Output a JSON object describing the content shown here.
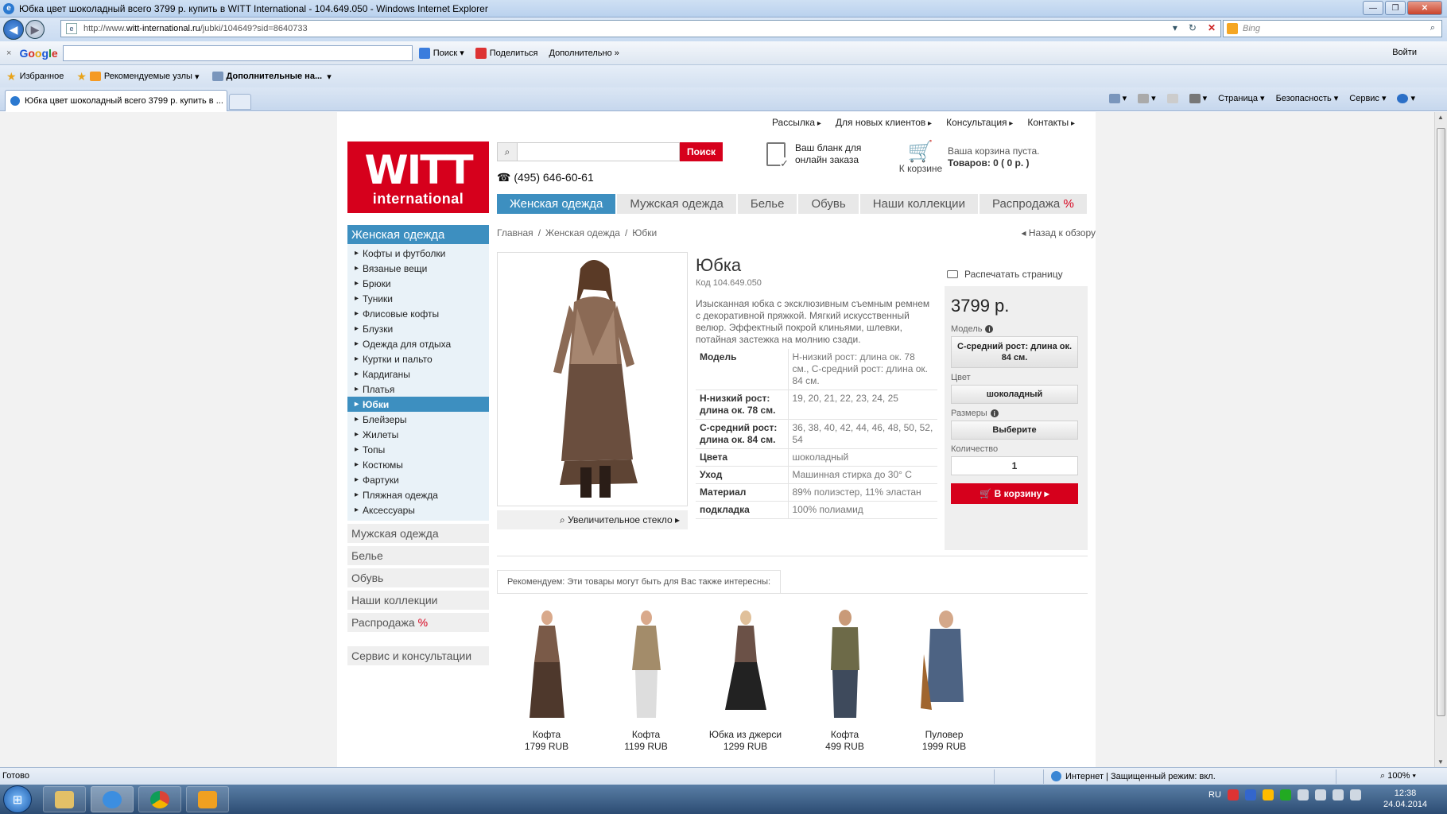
{
  "window": {
    "title": "Юбка цвет шоколадный всего 3799 р. купить в WITT International - 104.649.050 - Windows Internet Explorer",
    "url_prefix": "http://www.",
    "url_domain": "witt-international.ru",
    "url_path": "/jubki/104649?sid=8640733",
    "search_provider": "Bing"
  },
  "google_toolbar": {
    "close": "×",
    "search_label": "Поиск",
    "share_label": "Поделиться",
    "more_label": "Дополнительно »",
    "login_label": "Войти"
  },
  "favorites_bar": {
    "favorites": "Избранное",
    "suggested": "Рекомендуемые узлы",
    "addons": "Дополнительные на..."
  },
  "tabs": {
    "active_title": "Юбка цвет шоколадный всего 3799 р. купить в ..."
  },
  "command_bar": {
    "page": "Страница",
    "safety": "Безопасность",
    "service": "Сервис"
  },
  "site": {
    "top_links": [
      "Рассылка",
      "Для новых клиентов",
      "Консультация",
      "Контакты"
    ],
    "logo_main": "WITT",
    "logo_sub": "international",
    "search_button": "Поиск",
    "phone": "(495) 646-60-61",
    "order_form_line1": "Ваш бланк для",
    "order_form_line2": "онлайн заказа",
    "cart_link": "К корзине",
    "cart_empty": "Ваша корзина пуста.",
    "cart_items": "Товаров: 0 ( 0 р. )",
    "main_tabs": [
      {
        "label": "Женская одежда",
        "active": true
      },
      {
        "label": "Мужская одежда"
      },
      {
        "label": "Белье"
      },
      {
        "label": "Обувь"
      },
      {
        "label": "Наши коллекции"
      },
      {
        "label": "Распродажа",
        "suffix": "%"
      }
    ]
  },
  "sidebar": {
    "heading": "Женская одежда",
    "items": [
      "Кофты и футболки",
      "Вязаные вещи",
      "Брюки",
      "Туники",
      "Флисовые кофты",
      "Блузки",
      "Одежда для отдыха",
      "Куртки и пальто",
      "Кардиганы",
      "Платья",
      "Юбки",
      "Блейзеры",
      "Жилеты",
      "Топы",
      "Костюмы",
      "Фартуки",
      "Пляжная одежда",
      "Аксессуары"
    ],
    "active_item": "Юбки",
    "categories": [
      "Мужская одежда",
      "Белье",
      "Обувь",
      "Наши коллекции",
      "Распродажа"
    ],
    "sale_suffix": "%",
    "service": "Сервис и консультации"
  },
  "breadcrumb": {
    "home": "Главная",
    "category": "Женская одежда",
    "current": "Юбки",
    "sep": "/",
    "back": "◂ Назад к обзору"
  },
  "product": {
    "title": "Юбка",
    "code": "Код 104.649.050",
    "description": "Изысканная юбка с эксклюзивным съемным ремнем с декоративной пряжкой. Мягкий искусственный велюр. Эффектный покрой клиньями, шлевки, потайная застежка на молнию сзади.",
    "zoom_label": "Увеличительное стекло ▸",
    "properties": [
      {
        "key": "Модель",
        "value": "Н-низкий рост: длина ок. 78 см., С-средний рост: длина ок. 84 см."
      },
      {
        "key": "Н-низкий рост: длина ок. 78 см.",
        "value": "19, 20, 21, 22, 23, 24, 25"
      },
      {
        "key": "С-средний рост: длина ок. 84 см.",
        "value": "36, 38, 40, 42, 44, 46, 48, 50, 52, 54"
      },
      {
        "key": "Цвета",
        "value": "шоколадный"
      },
      {
        "key": "Уход",
        "value": "Машинная стирка до 30° C"
      },
      {
        "key": "Материал",
        "value": "89% полиэстер, 11% эластан"
      },
      {
        "key": "подкладка",
        "value": "100% полиамид"
      }
    ]
  },
  "buybox": {
    "print": "Распечатать страницу",
    "price": "3799 р.",
    "model_label": "Модель",
    "model_value": "С-средний рост: длина ок. 84 см.",
    "color_label": "Цвет",
    "color_value": "шоколадный",
    "size_label": "Размеры",
    "size_value": "Выберите",
    "qty_label": "Количество",
    "qty_value": "1",
    "add_to_cart": "В корзину ▸"
  },
  "recommendations": {
    "heading": "Рекомендуем: Эти товары могут быть для Вас также интересны:",
    "items": [
      {
        "name": "Кофта",
        "price": "1799 RUB"
      },
      {
        "name": "Кофта",
        "price": "1199 RUB"
      },
      {
        "name": "Юбка из джерси",
        "price": "1299 RUB"
      },
      {
        "name": "Кофта",
        "price": "499 RUB"
      },
      {
        "name": "Пуловер",
        "price": "1999 RUB"
      }
    ]
  },
  "statusbar": {
    "status": "Готово",
    "zone": "Интернет | Защищенный режим: вкл.",
    "zoom": "100%"
  },
  "taskbar": {
    "lang": "RU",
    "time": "12:38",
    "date": "24.04.2014"
  },
  "colors": {
    "brand_red": "#d6001c",
    "nav_blue": "#3d8fc0"
  }
}
